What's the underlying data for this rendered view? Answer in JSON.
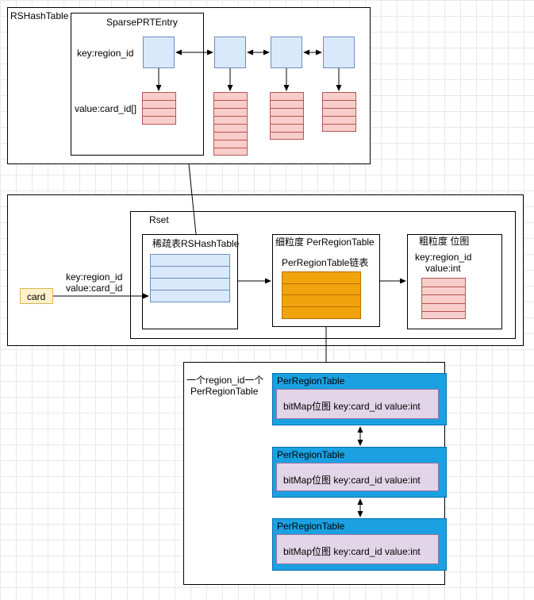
{
  "rshash": {
    "title": "RSHashTable",
    "entry_title": "SparsePRTEntry",
    "key_label": "key:region_id",
    "value_label": "value:card_id[]"
  },
  "rset": {
    "title": "Rset",
    "sparse_title": "稀疏表RSHashTable",
    "fine_title": "细粒度 PerRegionTable",
    "fine_list_label": "PerRegionTable链表",
    "coarse_title": "粗粒度 位图",
    "coarse_key": "key:region_id",
    "coarse_value": "value:int",
    "input_key": "key:region_id",
    "input_value": "value:card_id",
    "card_label": "card"
  },
  "detail": {
    "caption_line1": "一个region_id一个",
    "caption_line2": "PerRegionTable",
    "tables": [
      {
        "title": "PerRegionTable",
        "content": "bitMap位图  key:card_id value:int"
      },
      {
        "title": "PerRegionTable",
        "content": "bitMap位图  key:card_id value:int"
      },
      {
        "title": "PerRegionTable",
        "content": "bitMap位图  key:card_id value:int"
      }
    ]
  },
  "colors": {
    "blue_fill": "#dae8fc",
    "red_fill": "#f8cecc",
    "orange_fill": "#f0a30a",
    "prt_fill": "#1ba1e2",
    "purple_fill": "#e1d5e7",
    "card_fill": "#fff2cc"
  }
}
